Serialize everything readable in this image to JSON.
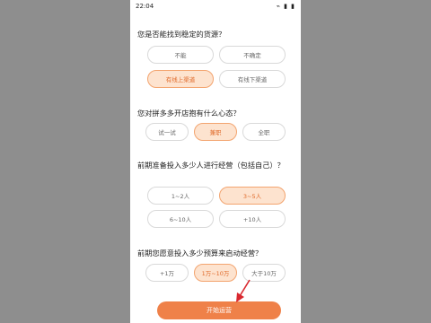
{
  "status": {
    "time": "22:04",
    "icons": "⌁ ▮ ▮"
  },
  "questions": [
    {
      "title": "您是否能找到稳定的货源？",
      "options": [
        "不能",
        "不确定",
        "有线上渠道",
        "有线下渠道"
      ],
      "selected": 2
    },
    {
      "title": "您对拼多多开店抱有什么心态？",
      "options": [
        "试一试",
        "兼职",
        "全职"
      ],
      "selected": 1
    },
    {
      "title": "前期准备投入多少人进行经营（包括自己）？",
      "options": [
        "1~2人",
        "3~5人",
        "6~10人",
        "+10人"
      ],
      "selected": 1
    },
    {
      "title": "前期您愿意投入多少预算来启动经营？",
      "options": [
        "+1万",
        "1万~10万",
        "大于10万"
      ],
      "selected": 1
    }
  ],
  "start_button": "开始运营",
  "colors": {
    "accent": "#ef8149",
    "selected_bg": "#fde3cf",
    "arrow": "#d9282f"
  }
}
